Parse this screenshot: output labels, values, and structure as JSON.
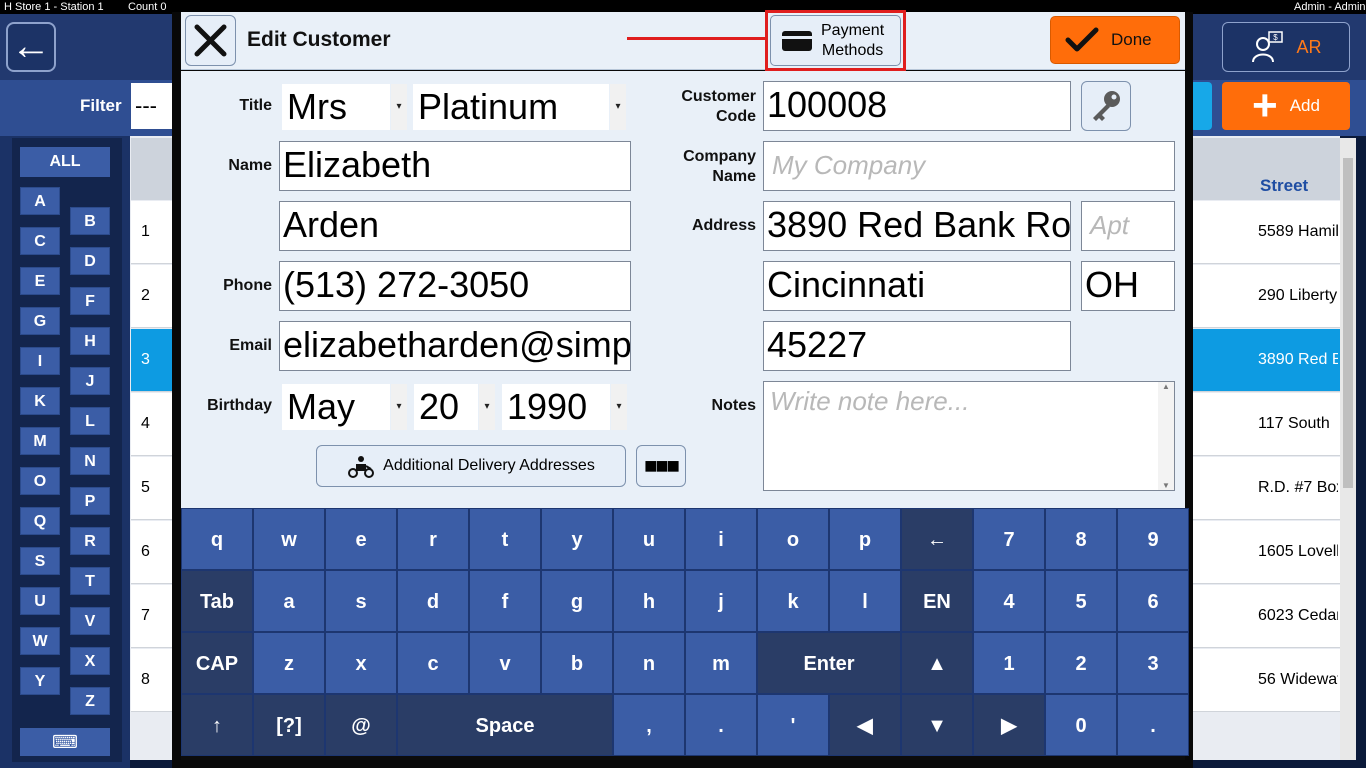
{
  "topbar": {
    "store": "H   Store 1 - Station 1",
    "count": "Count 0",
    "user": "Admin - Admin"
  },
  "header": {
    "ar_label": "AR",
    "add_label": "Add"
  },
  "filter": {
    "label": "Filter",
    "value": "---"
  },
  "alpha": {
    "all": "ALL",
    "letters_left": [
      "A",
      "C",
      "E",
      "G",
      "I",
      "K",
      "M",
      "O",
      "Q",
      "S",
      "U",
      "W",
      "Y"
    ],
    "letters_right": [
      "B",
      "D",
      "F",
      "H",
      "J",
      "L",
      "N",
      "P",
      "R",
      "T",
      "V",
      "X",
      "Z"
    ]
  },
  "list": {
    "street_header": "Street",
    "rows": [
      {
        "num": "1",
        "street": "5589 Hamil"
      },
      {
        "num": "2",
        "street": "290 Liberty"
      },
      {
        "num": "3",
        "street": "3890 Red B"
      },
      {
        "num": "4",
        "street": "117 South"
      },
      {
        "num": "5",
        "street": "R.D. #7 Box"
      },
      {
        "num": "6",
        "street": "1605 Lovell"
      },
      {
        "num": "7",
        "street": "6023 Cedar"
      },
      {
        "num": "8",
        "street": "56 Widewat"
      }
    ]
  },
  "modal": {
    "title": "Edit Customer",
    "payment_methods": "Payment Methods",
    "payment_line1": "Payment",
    "payment_line2": "Methods",
    "done": "Done",
    "labels": {
      "title": "Title",
      "name": "Name",
      "phone": "Phone",
      "email": "Email",
      "birthday": "Birthday",
      "customer_code_1": "Customer",
      "customer_code_2": "Code",
      "company_name_1": "Company",
      "company_name_2": "Name",
      "address": "Address",
      "notes": "Notes"
    },
    "fields": {
      "title": "Mrs",
      "tier": "Platinum",
      "first_name": "Elizabeth",
      "last_name": "Arden",
      "phone": "(513) 272-3050",
      "email": "elizabetharden@simp",
      "birth_month": "May",
      "birth_day": "20",
      "birth_year": "1990",
      "customer_code": "100008",
      "company_placeholder": "My Company",
      "address": "3890 Red Bank Ro",
      "apt_placeholder": "Apt",
      "city": "Cincinnati",
      "state": "OH",
      "zip": "45227",
      "notes_placeholder": "Write note here..."
    },
    "additional_addresses": "Additional Delivery Addresses",
    "more": "■■■"
  },
  "keyboard": {
    "row1": [
      "q",
      "w",
      "e",
      "r",
      "t",
      "y",
      "u",
      "i",
      "o",
      "p",
      "←",
      "7",
      "8",
      "9"
    ],
    "row2": [
      "Tab",
      "a",
      "s",
      "d",
      "f",
      "g",
      "h",
      "j",
      "k",
      "l",
      "EN",
      "4",
      "5",
      "6"
    ],
    "row3": [
      "CAP",
      "z",
      "x",
      "c",
      "v",
      "b",
      "n",
      "m",
      "Enter",
      "▲",
      "1",
      "2",
      "3"
    ],
    "row4": [
      "↑",
      "[?]",
      "@",
      "Space",
      ",",
      ".",
      "'",
      "◀",
      "▼",
      "▶",
      "0",
      "."
    ]
  }
}
